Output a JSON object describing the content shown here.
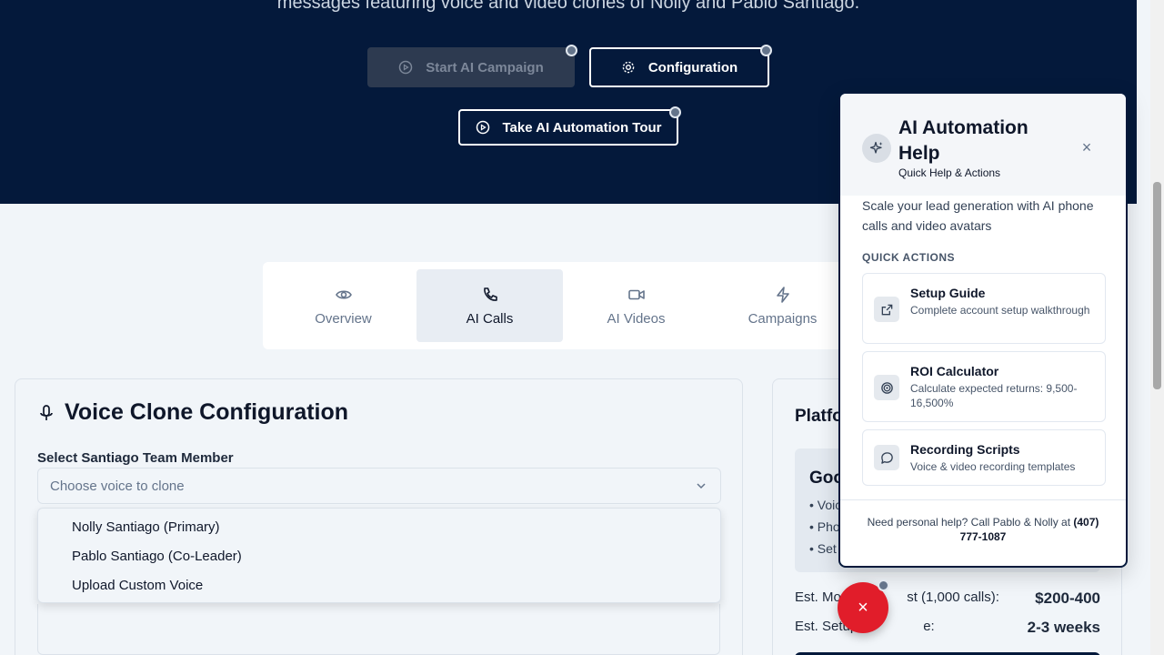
{
  "hero": {
    "text": "messages featuring voice and video clones of Nolly and Pablo Santiago.",
    "start_label": "Start AI Campaign",
    "config_label": "Configuration",
    "tour_label": "Take AI Automation Tour"
  },
  "tabs": [
    {
      "label": "Overview",
      "icon": "eye-icon"
    },
    {
      "label": "AI Calls",
      "icon": "phone-icon"
    },
    {
      "label": "AI Videos",
      "icon": "video-icon"
    },
    {
      "label": "Campaigns",
      "icon": "lightning-icon"
    }
  ],
  "voice": {
    "title": "Voice Clone Configuration",
    "field_label": "Select Santiago Team Member",
    "placeholder": "Choose voice to clone",
    "options": [
      "Nolly Santiago (Primary)",
      "Pablo Santiago (Co-Leader)",
      "Upload Custom Voice"
    ]
  },
  "platform": {
    "title_partial": "Platfo",
    "inner_title_partial": "Goo",
    "items": [
      "• Voic",
      "• Pho",
      "• Set"
    ],
    "cost_label": "Est. Mon",
    "cost_label_tail": "st (1,000 calls):",
    "cost_value": "$200-400",
    "setup_label": "Est. Setup",
    "setup_label_tail": "e:",
    "setup_value": "2-3 weeks"
  },
  "help": {
    "title": "AI Automation Help",
    "subtitle": "Quick Help & Actions",
    "description": "Scale your lead generation with AI phone calls and video avatars",
    "section": "QUICK ACTIONS",
    "actions": [
      {
        "title": "Setup Guide",
        "desc": "Complete account setup walkthrough",
        "icon": "external-link-icon"
      },
      {
        "title": "ROI Calculator",
        "desc": "Calculate expected returns: 9,500-16,500%",
        "icon": "target-icon"
      },
      {
        "title": "Recording Scripts",
        "desc": "Voice & video recording templates",
        "icon": "chat-bubble-icon"
      }
    ],
    "footer_text": "Need personal help? Call Pablo & Nolly at ",
    "footer_phone": "(407) 777-1087"
  },
  "fab_symbol": "×",
  "close_symbol": "×",
  "colors": {
    "navy": "#04193b",
    "fab_red": "#e11d2a"
  }
}
